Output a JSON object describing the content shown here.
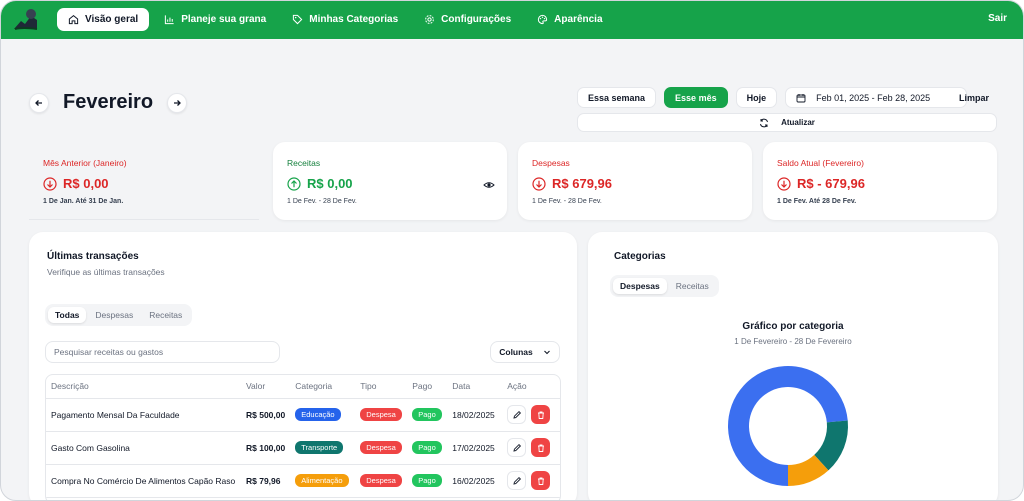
{
  "nav": {
    "items": [
      {
        "label": "Visão geral",
        "icon": "home-icon",
        "active": true
      },
      {
        "label": "Planeje sua grana",
        "icon": "bar-chart-icon",
        "active": false
      },
      {
        "label": "Minhas Categorias",
        "icon": "tag-icon",
        "active": false
      },
      {
        "label": "Configurações",
        "icon": "gear-icon",
        "active": false
      },
      {
        "label": "Aparência",
        "icon": "palette-icon",
        "active": false
      }
    ],
    "logout": "Sair"
  },
  "header": {
    "month": "Fevereiro",
    "filters": {
      "week": "Essa semana",
      "month": "Esse mês",
      "today": "Hoje",
      "date_range": "Feb 01, 2025 - Feb 28, 2025",
      "clear": "Limpar",
      "refresh": "Atualizar"
    }
  },
  "cards": [
    {
      "label": "Mês Anterior (Janeiro)",
      "value": "R$ 0,00",
      "sub": "1 De Jan. Até 31 De Jan."
    },
    {
      "label": "Receitas",
      "value": "R$ 0,00",
      "sub": "1 De Fev. - 28 De Fev."
    },
    {
      "label": "Despesas",
      "value": "R$ 679,96",
      "sub": "1 De Fev. - 28 De Fev."
    },
    {
      "label": "Saldo Atual (Fevereiro)",
      "value": "R$ - 679,96",
      "sub": "1 De Fev. Até 28 De Fev."
    }
  ],
  "transactions": {
    "title": "Últimas transações",
    "subtitle": "Verifique as últimas transações",
    "tabs": [
      "Todas",
      "Despesas",
      "Receitas"
    ],
    "search_placeholder": "Pesquisar receitas ou gastos",
    "columns_button": "Colunas",
    "columns": [
      "Descrição",
      "Valor",
      "Categoria",
      "Tipo",
      "Pago",
      "Data",
      "Ação"
    ],
    "rows": [
      {
        "descricao": "Pagamento Mensal Da Faculdade",
        "valor": "R$ 500,00",
        "categoria": "Educação",
        "tipo": "Despesa",
        "pago": "Pago",
        "data": "18/02/2025"
      },
      {
        "descricao": "Gasto Com Gasolina",
        "valor": "R$ 100,00",
        "categoria": "Transporte",
        "tipo": "Despesa",
        "pago": "Pago",
        "data": "17/02/2025"
      },
      {
        "descricao": "Compra No Comércio De Alimentos Capão Raso",
        "valor": "R$ 79,96",
        "categoria": "Alimentação",
        "tipo": "Despesa",
        "pago": "Pago",
        "data": "16/02/2025"
      }
    ]
  },
  "categories": {
    "title": "Categorias",
    "tabs": [
      "Despesas",
      "Receitas"
    ],
    "chart_title": "Gráfico por categoria",
    "chart_subtitle": "1 De Fevereiro - 28 De Fevereiro"
  },
  "colors": {
    "brand": "#16a34a",
    "negative": "#dc2626",
    "educacao": "#2563eb",
    "transporte": "#0f766e",
    "alimentacao": "#f59e0b",
    "despesa": "#ef4444",
    "pago": "#22c55e"
  },
  "chart_data": {
    "type": "pie",
    "categories": [
      "Educação",
      "Transporte",
      "Alimentação"
    ],
    "values": [
      500.0,
      100.0,
      79.96
    ],
    "colors": [
      "#3b6ff0",
      "#0f766e",
      "#f59e0b"
    ]
  }
}
